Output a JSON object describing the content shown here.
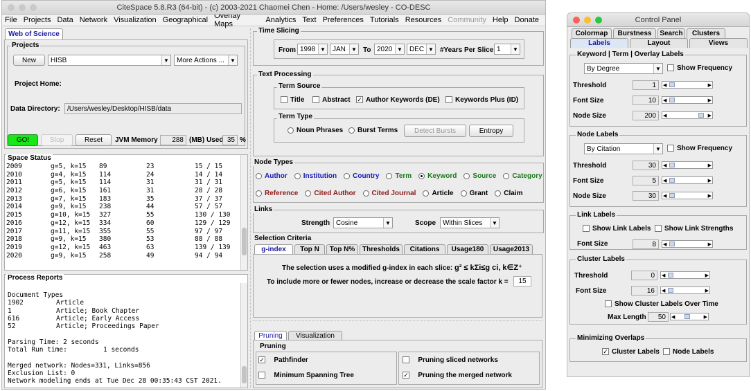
{
  "main": {
    "title": "CiteSpace 5.8.R3 (64-bit) - (c) 2003-2021 Chaomei Chen - Home: /Users/wesley - CO-DESC",
    "menu": [
      "File",
      "Projects",
      "Data",
      "Network",
      "Visualization",
      "Geographical",
      "Overlay Maps",
      "Analytics",
      "Text",
      "Preferences",
      "Tutorials",
      "Resources",
      "Community",
      "Help",
      "Donate"
    ],
    "wos_tab": "Web of Science",
    "projects": {
      "label": "Projects",
      "new": "New",
      "project": "HISB",
      "more": "More Actions ...",
      "home_label": "Project Home:",
      "dir_label": "Data Directory:",
      "dir_value": "/Users/wesley/Desktop/HISB/data"
    },
    "controls": {
      "go": "GO!",
      "stop": "Stop",
      "reset": "Reset",
      "jvm_label": "JVM Memory",
      "jvm_value": "288",
      "used_label": "(MB) Used",
      "used_value": "35",
      "pct": "%"
    },
    "space_status": {
      "label": "Space Status",
      "rows": [
        [
          "2009",
          "g=5, k=15",
          "89",
          "23",
          "15 / 15"
        ],
        [
          "2010",
          "g=4, k=15",
          "114",
          "24",
          "14 / 14"
        ],
        [
          "2011",
          "g=5, k=15",
          "114",
          "31",
          "31 / 31"
        ],
        [
          "2012",
          "g=6, k=15",
          "161",
          "31",
          "28 / 28"
        ],
        [
          "2013",
          "g=7, k=15",
          "183",
          "35",
          "37 / 37"
        ],
        [
          "2014",
          "g=9, k=15",
          "238",
          "44",
          "57 / 57"
        ],
        [
          "2015",
          "g=10, k=15",
          "327",
          "55",
          "130 / 130"
        ],
        [
          "2016",
          "g=12, k=15",
          "334",
          "60",
          "129 / 129"
        ],
        [
          "2017",
          "g=11, k=15",
          "355",
          "55",
          "97 / 97"
        ],
        [
          "2018",
          "g=9, k=15",
          "380",
          "53",
          "88 / 88"
        ],
        [
          "2019",
          "g=12, k=15",
          "463",
          "63",
          "139 / 139"
        ],
        [
          "2020",
          "g=9, k=15",
          "258",
          "49",
          "94 / 94"
        ]
      ]
    },
    "process": {
      "label": "Process Reports",
      "doc_types": "Document Types",
      "types": [
        [
          "1902",
          "Article"
        ],
        [
          "1",
          "Article; Book Chapter"
        ],
        [
          "616",
          "Article; Early Access"
        ],
        [
          "52",
          "Article; Proceedings Paper"
        ]
      ],
      "parsing": "Parsing Time:  2 seconds",
      "total": "Total Run time:",
      "total_val": "1 seconds",
      "merged": "Merged network: Nodes=331, Links=856",
      "exclusion": "Exclusion List: 0",
      "ends": "Network modeling ends at Tue Dec 28 00:35:43 CST 2021."
    },
    "time_slicing": {
      "label": "Time Slicing",
      "from": "From",
      "from_year": "1998",
      "from_month": "JAN",
      "to": "To",
      "to_year": "2020",
      "to_month": "DEC",
      "years_label": "#Years Per Slice",
      "years_value": "1"
    },
    "text_processing": {
      "label": "Text Processing",
      "term_source": "Term Source",
      "title": "Title",
      "abstract": "Abstract",
      "author_kw": "Author Keywords (DE)",
      "kw_plus": "Keywords Plus (ID)",
      "term_type": "Term Type",
      "noun": "Noun Phrases",
      "burst": "Burst Terms",
      "detect": "Detect Bursts",
      "entropy": "Entropy"
    },
    "node_types": {
      "label": "Node Types",
      "row1": [
        {
          "t": "Author",
          "c": "#1a1ab0"
        },
        {
          "t": "Institution",
          "c": "#1a1ab0"
        },
        {
          "t": "Country",
          "c": "#1a1ab0"
        },
        {
          "t": "Term",
          "c": "#1a7a1a"
        },
        {
          "t": "Keyword",
          "c": "#1a7a1a"
        },
        {
          "t": "Source",
          "c": "#1a7a1a"
        },
        {
          "t": "Category",
          "c": "#1a7a1a"
        }
      ],
      "row2": [
        {
          "t": "Reference",
          "c": "#8a1a1a"
        },
        {
          "t": "Cited Author",
          "c": "#8a1a1a"
        },
        {
          "t": "Cited Journal",
          "c": "#8a1a1a"
        },
        {
          "t": "Article",
          "c": "#000000"
        },
        {
          "t": "Grant",
          "c": "#000000"
        },
        {
          "t": "Claim",
          "c": "#000000"
        }
      ]
    },
    "links": {
      "label": "Links",
      "strength": "Strength",
      "strength_val": "Cosine",
      "scope": "Scope",
      "scope_val": "Within Slices"
    },
    "selection": {
      "label": "Selection Criteria",
      "tabs": [
        "g-index",
        "Top N",
        "Top N%",
        "Thresholds",
        "Citations",
        "Usage180",
        "Usage2013"
      ],
      "line1": "The selection uses a modified g-index in each slice:",
      "formula": "g² ≤ kΣi≤g ci, k∈Z⁺",
      "line2": "To include more or fewer nodes, increase or decrease the scale factor k =",
      "k": "15"
    },
    "pruning": {
      "tabs": [
        "Pruning",
        "Visualization"
      ],
      "label": "Pruning",
      "pathfinder": "Pathfinder",
      "mst": "Minimum Spanning Tree",
      "sliced": "Pruning sliced networks",
      "merged": "Pruning the merged network"
    }
  },
  "panel": {
    "title": "Control Panel",
    "tabs_row1": [
      "Colormap",
      "Burstness",
      "Search",
      "Clusters"
    ],
    "tabs_row2": [
      "Labels",
      "Layout",
      "Views"
    ],
    "kw_labels": {
      "label": "Keyword | Term | Overlay Labels",
      "mode": "By Degree",
      "show_freq": "Show Frequency",
      "threshold": "Threshold",
      "threshold_val": "1",
      "font": "Font Size",
      "font_val": "10",
      "node": "Node Size",
      "node_val": "200"
    },
    "node_labels": {
      "label": "Node Labels",
      "mode": "By Citation",
      "show_freq": "Show Frequency",
      "threshold": "Threshold",
      "threshold_val": "30",
      "font": "Font Size",
      "font_val": "5",
      "node": "Node Size",
      "node_val": "30"
    },
    "link_labels": {
      "label": "Link Labels",
      "show": "Show Link Labels",
      "strengths": "Show Link Strengths",
      "font": "Font Size",
      "font_val": "8"
    },
    "cluster_labels": {
      "label": "Cluster Labels",
      "threshold": "Threshold",
      "threshold_val": "0",
      "font": "Font Size",
      "font_val": "16",
      "over_time": "Show Cluster Labels Over Time",
      "maxlen": "Max Length",
      "maxlen_val": "50"
    },
    "overlaps": {
      "label": "Minimizing Overlaps",
      "cluster": "Cluster Labels",
      "node": "Node Labels"
    }
  }
}
